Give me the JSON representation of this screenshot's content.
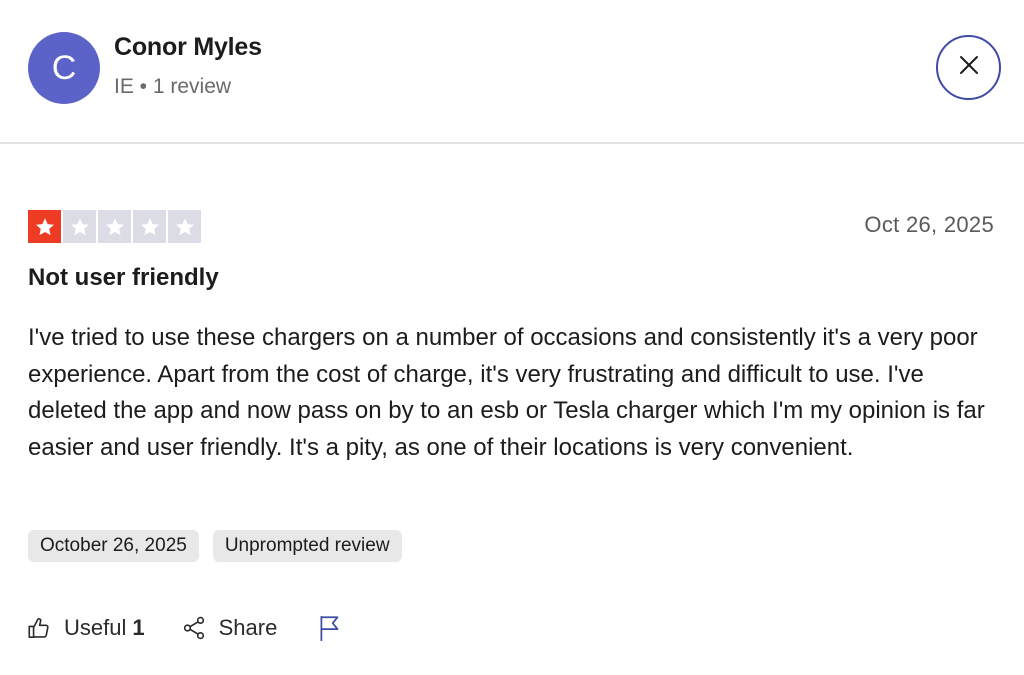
{
  "reviewer": {
    "initial": "C",
    "name": "Conor Myles",
    "meta": "IE • 1 review",
    "avatar_color": "#5b63c9"
  },
  "rating": {
    "value": 1,
    "max": 5,
    "filled_color": "#ee3b23",
    "empty_color": "#dcdce6"
  },
  "review": {
    "date": "Oct 26, 2025",
    "title": "Not user friendly",
    "body": "I've tried to use these chargers on a number of occasions and consistently it's a very poor experience. Apart from the cost of charge, it's very frustrating and difficult to use. I've deleted the app and now pass on by to an esb or Tesla charger which I'm my opinion is far easier and user friendly. It's a pity, as one of their locations is very convenient."
  },
  "tags": [
    "October 26, 2025",
    "Unprompted review"
  ],
  "actions": {
    "useful_label": "Useful",
    "useful_count": "1",
    "share_label": "Share",
    "useful_icon": "thumbs-up-icon",
    "share_icon": "share-icon",
    "report_icon": "flag-icon"
  },
  "icons": {
    "close": "close-icon"
  },
  "colors": {
    "close_border": "#3d4ba5"
  }
}
